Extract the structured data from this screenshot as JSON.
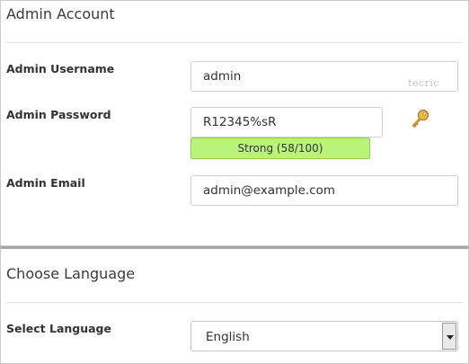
{
  "admin_section": {
    "title": "Admin Account",
    "username_label": "Admin Username",
    "username_value": "admin",
    "username_watermark": "tecric",
    "password_label": "Admin Password",
    "password_value": "R12345%sR",
    "strength_text": "Strong (58/100)",
    "email_label": "Admin Email",
    "email_value": "admin@example.com"
  },
  "language_section": {
    "title": "Choose Language",
    "select_label": "Select Language",
    "selected_language": "English"
  },
  "icons": {
    "password_generator": "key-icon",
    "dropdown": "chevron-down-icon"
  },
  "colors": {
    "strength_background": "#b9f37a",
    "strength_border": "#8fcf4c",
    "key_icon": "#e0a020"
  }
}
